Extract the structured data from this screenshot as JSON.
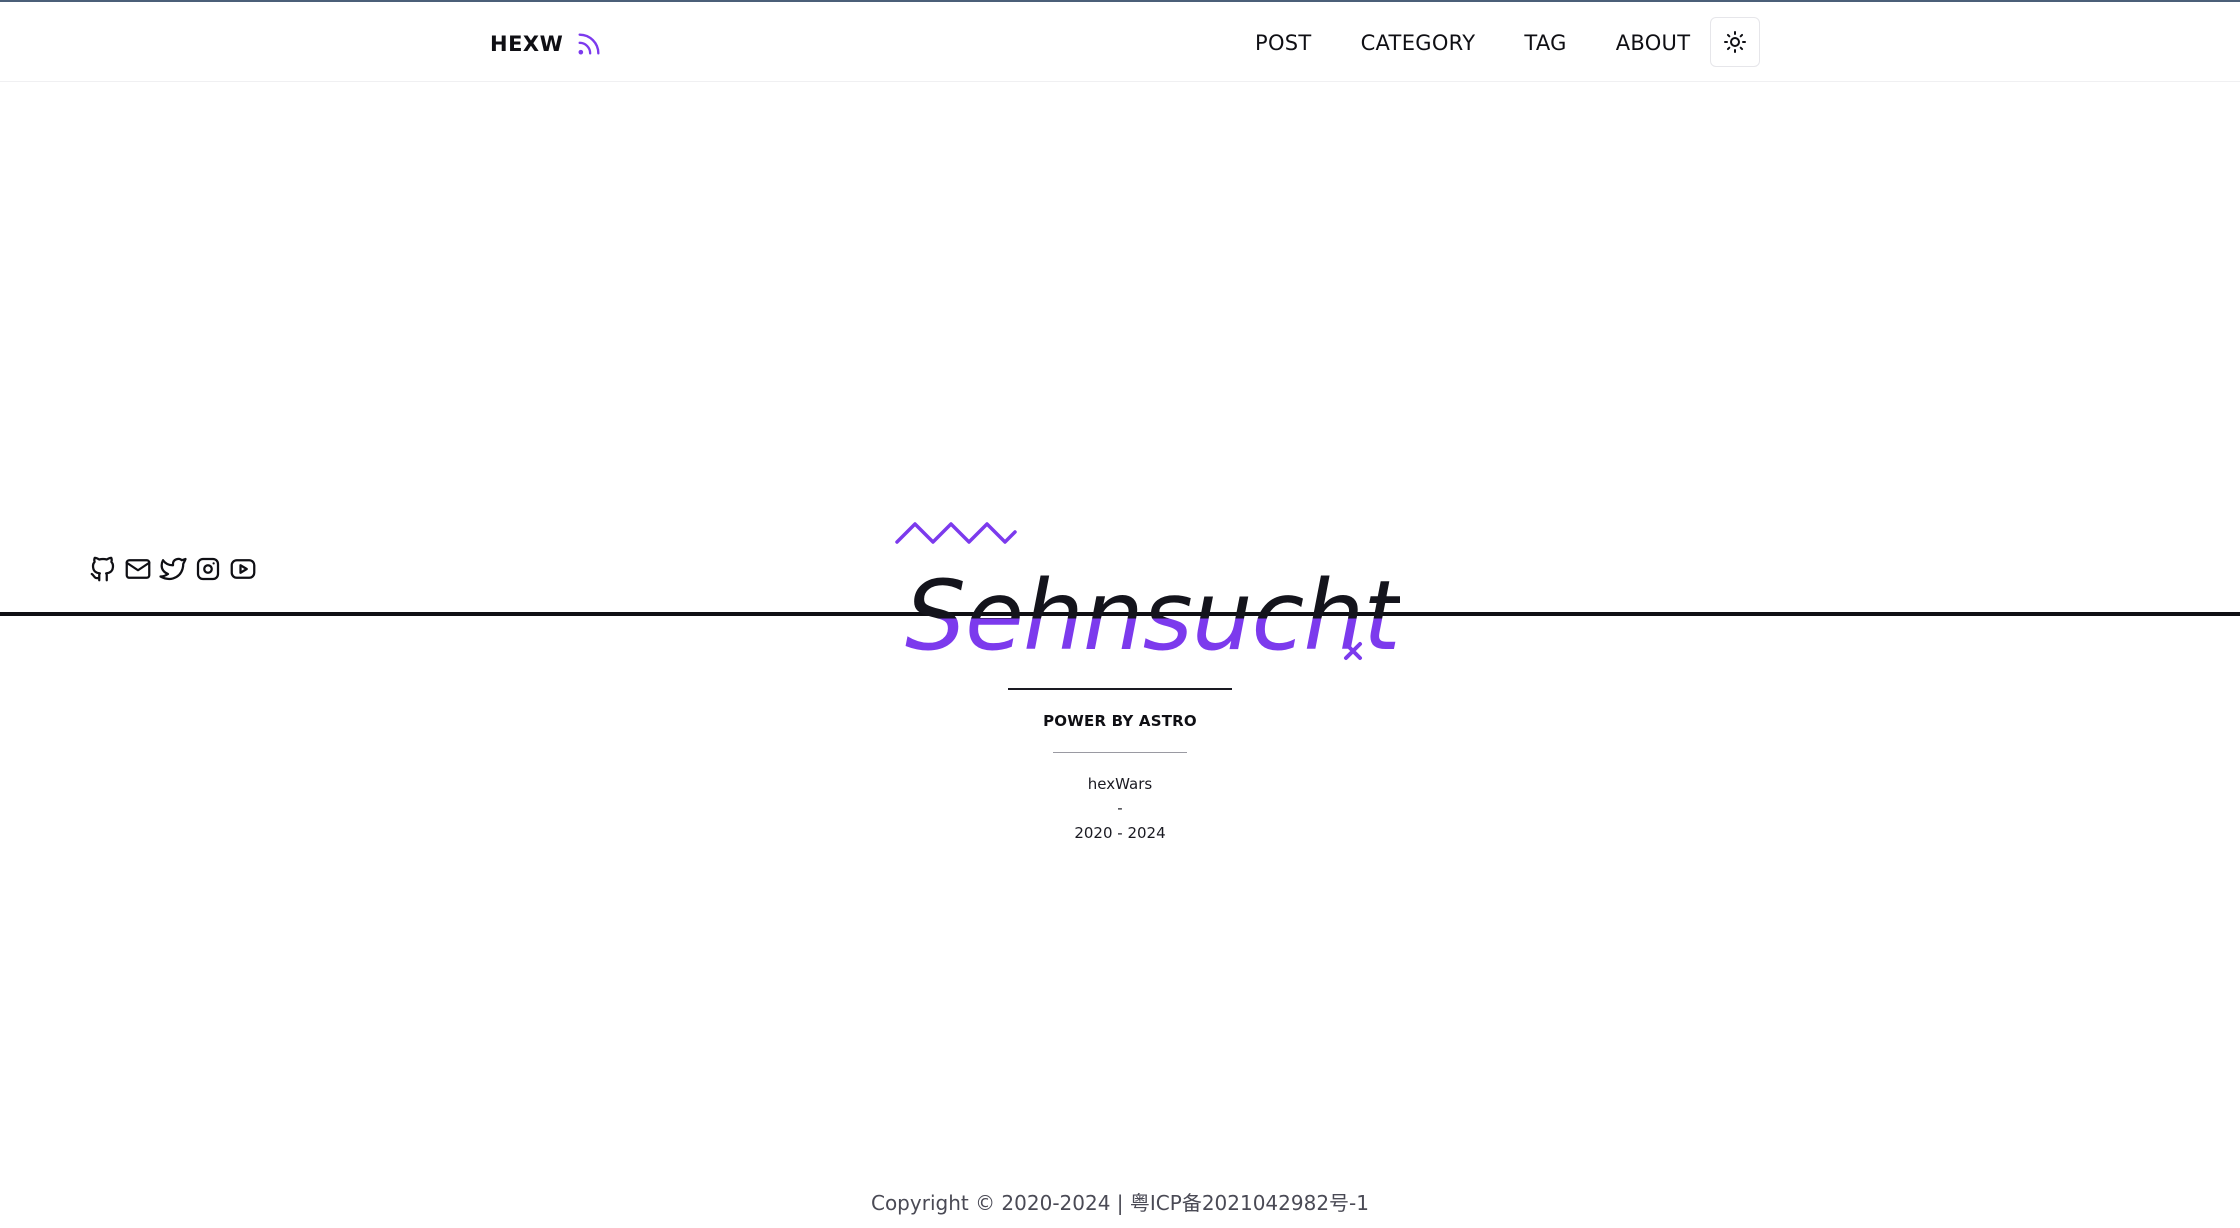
{
  "header": {
    "brand": "HEXW",
    "nav": [
      {
        "label": "POST"
      },
      {
        "label": "CATEGORY"
      },
      {
        "label": "TAG"
      },
      {
        "label": "ABOUT"
      }
    ]
  },
  "social": {
    "icons": [
      "github-icon",
      "mail-icon",
      "twitter-icon",
      "instagram-icon",
      "youtube-icon"
    ]
  },
  "hero": {
    "title": "Sehnsucht"
  },
  "footer": {
    "power": "POWER BY ASTRO",
    "author": "hexWars",
    "dash": "-",
    "years": "2020 - 2024",
    "copyright_prefix": "Copyright © 2020-2024 | ",
    "icp": "粤ICP备2021042982号-1"
  },
  "colors": {
    "accent": "#7c3aed",
    "text": "#0f0f14",
    "muted": "#4a4a55"
  }
}
